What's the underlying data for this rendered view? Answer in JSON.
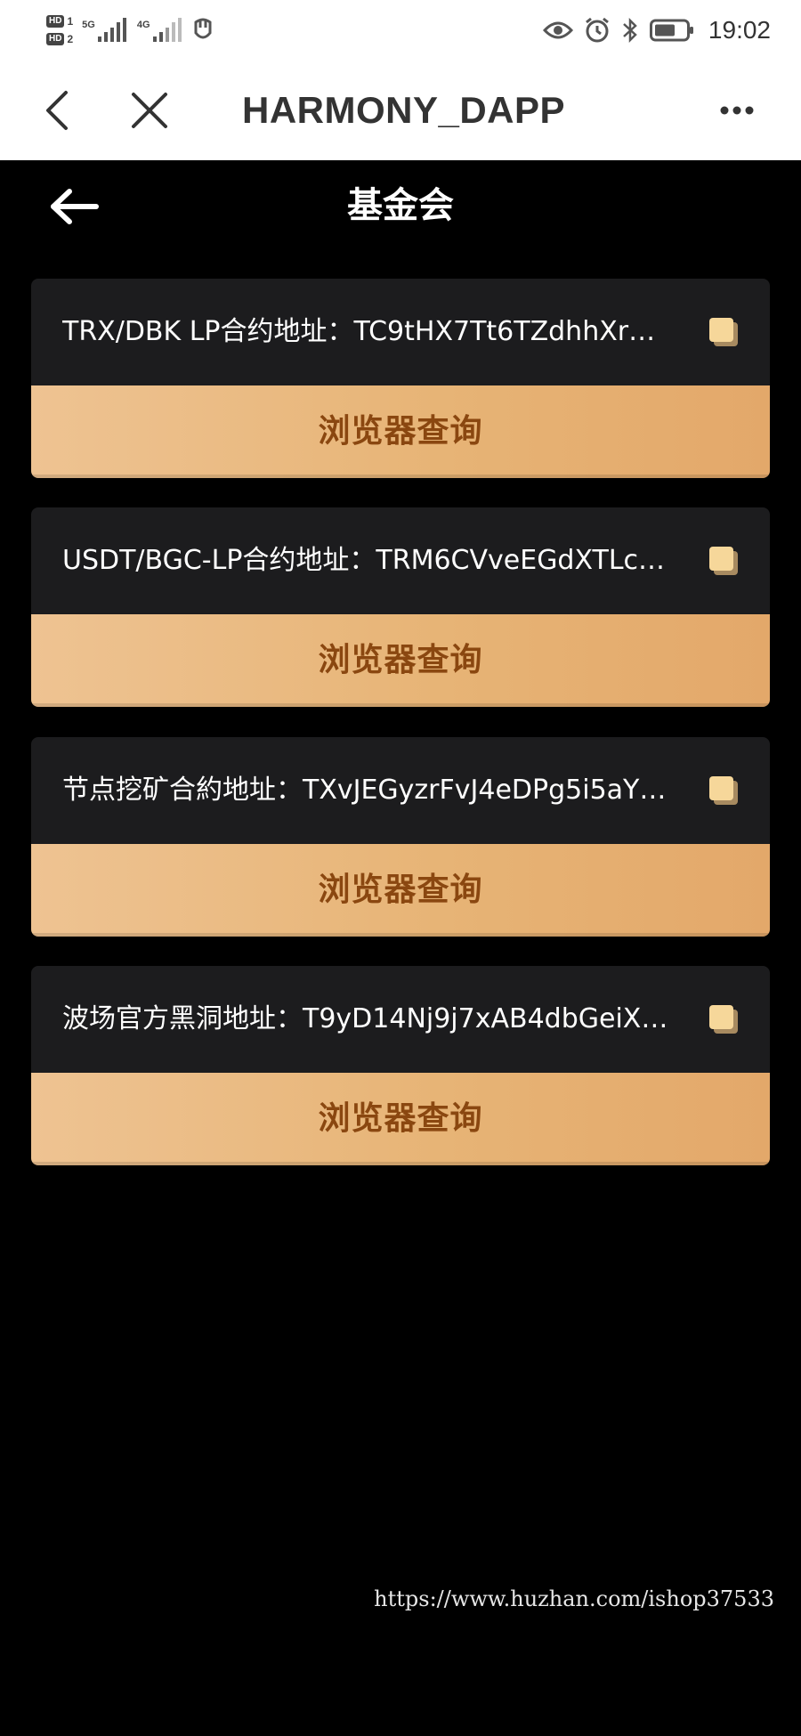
{
  "status_bar": {
    "sim1_label": "HD",
    "sim1_num": "1",
    "sim2_label": "HD",
    "sim2_num": "2",
    "net1": "5G",
    "net2": "4G",
    "time": "19:02",
    "icons": [
      "signal-icon",
      "usb-icon",
      "eye-icon",
      "alarm-icon",
      "bluetooth-icon",
      "battery-icon"
    ]
  },
  "nav": {
    "title": "HARMONY_DAPP",
    "icons": [
      "back-chevron-icon",
      "close-icon",
      "more-icon"
    ]
  },
  "page": {
    "title": "基金会"
  },
  "cards": [
    {
      "label": "TRX/DBK LP合约地址：TC9tHX7Tt6TZdhhXr…",
      "button": "浏览器查询"
    },
    {
      "label": "USDT/BGC-LP合约地址：TRM6CVveEGdXTLc…",
      "button": "浏览器查询"
    },
    {
      "label": "节点挖矿合約地址：TXvJEGyzrFvJ4eDPg5i5aY…",
      "button": "浏览器查询"
    },
    {
      "label": "波场官方黑洞地址：T9yD14Nj9j7xAB4dbGeiX…",
      "button": "浏览器查询"
    }
  ],
  "watermark": "https://www.huzhan.com/ishop37533",
  "colors": {
    "background": "#000000",
    "card": "#1c1c1e",
    "button_gradient_start": "#eec392",
    "button_gradient_end": "#e3a86a",
    "button_text": "#8a4710",
    "copy_icon": "#f6d79a"
  }
}
